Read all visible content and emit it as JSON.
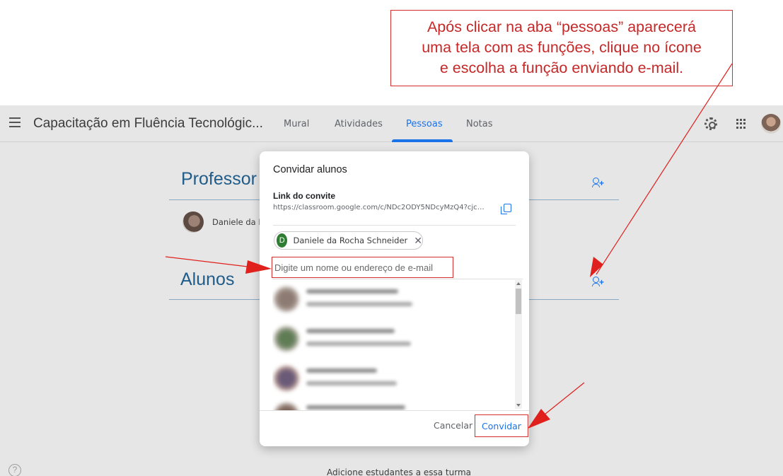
{
  "callout": {
    "line1": "Após clicar na aba “pessoas” aparecerá",
    "line2": "uma tela com as funções, clique no ícone",
    "line3": "e escolha a função enviando e-mail."
  },
  "header": {
    "course_title": "Capacitação em Fluência Tecnológic...",
    "tabs": [
      {
        "label": "Mural",
        "active": false
      },
      {
        "label": "Atividades",
        "active": false
      },
      {
        "label": "Pessoas",
        "active": true
      },
      {
        "label": "Notas",
        "active": false
      }
    ]
  },
  "people": {
    "teachers_title": "Professor",
    "teacher_name": "Daniele da R",
    "students_title": "Alunos",
    "footer_text": "Adicione estudantes a essa turma",
    "help_glyph": "?"
  },
  "dialog": {
    "title": "Convidar alunos",
    "link_label": "Link do convite",
    "link_url": "https://classroom.google.com/c/NDc2ODY5NDcyMzQ4?cjc=pp...",
    "chip": {
      "initial": "D",
      "name": "Daniele da Rocha Schneider",
      "close_glyph": "✕"
    },
    "search_placeholder": "Digite um nome ou endereço de e-mail",
    "cancel_label": "Cancelar",
    "invite_label": "Convidar"
  },
  "colors": {
    "accent": "#1a73e8",
    "annotation": "#d32f2f",
    "chip_avatar": "#2e7d32"
  }
}
